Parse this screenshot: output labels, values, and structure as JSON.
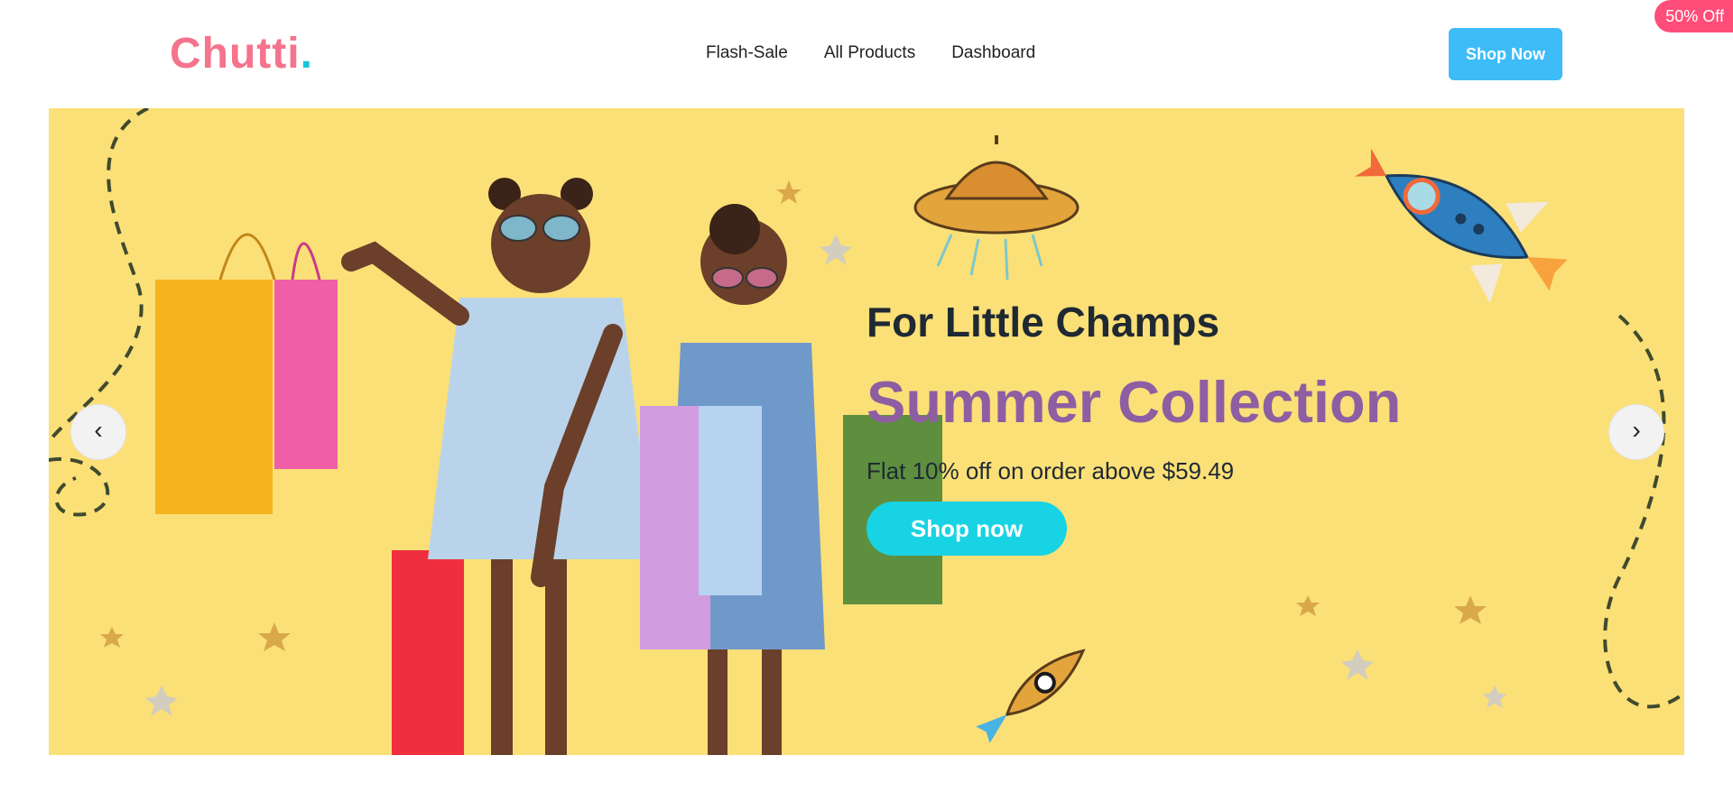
{
  "promo_badge": "50% Off",
  "brand": {
    "name": "Chutti",
    "dot": "."
  },
  "nav": {
    "items": [
      {
        "label": "Flash-Sale"
      },
      {
        "label": "All Products"
      },
      {
        "label": "Dashboard"
      }
    ]
  },
  "header": {
    "shop_button": "Shop Now"
  },
  "hero": {
    "tagline": "For Little Champs",
    "title": "Summer Collection",
    "offer": "Flat 10% off on order above $59.49",
    "cta": "Shop now",
    "prev_symbol": "‹",
    "next_symbol": "›"
  },
  "colors": {
    "brand": "#f5738c",
    "accent": "#16c6e1",
    "hero_bg": "#fbe077",
    "title": "#8e5ea2",
    "button": "#3ebcf7",
    "badge": "#ff4d79"
  }
}
